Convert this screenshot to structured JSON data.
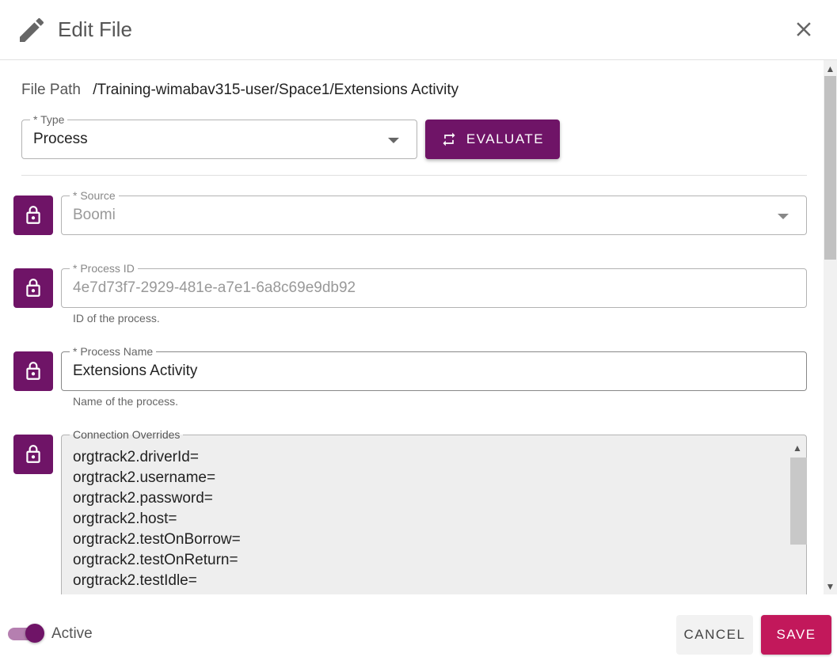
{
  "dialog": {
    "title": "Edit File",
    "icons": {
      "title": "pencil-icon",
      "close": "close-icon"
    }
  },
  "file_path": {
    "label": "File Path",
    "value": "/Training-wimabav315-user/Space1/Extensions Activity"
  },
  "type_field": {
    "label": "* Type",
    "value": "Process"
  },
  "evaluate_button": {
    "label": "EVALUATE",
    "icon": "swap-arrows-icon"
  },
  "source_field": {
    "label": "* Source",
    "value": "Boomi",
    "disabled": true
  },
  "process_id_field": {
    "label": "* Process ID",
    "value": "4e7d73f7-2929-481e-a7e1-6a8c69e9db92",
    "helper": "ID of the process.",
    "disabled": true
  },
  "process_name_field": {
    "label": "* Process Name",
    "value": "Extensions Activity",
    "helper": "Name of the process."
  },
  "connection_overrides": {
    "label": "Connection Overrides",
    "lines": [
      "orgtrack2.driverId=",
      "orgtrack2.username=",
      "orgtrack2.password=",
      "orgtrack2.host=",
      "orgtrack2.testOnBorrow=",
      "orgtrack2.testOnReturn=",
      "orgtrack2.testIdle="
    ]
  },
  "footer": {
    "active_label": "Active",
    "active_on": true,
    "cancel_label": "CANCEL",
    "save_label": "SAVE"
  },
  "colors": {
    "primary": "#6f1467",
    "save": "#c2185b",
    "toggle_track": "#b57fb0"
  }
}
